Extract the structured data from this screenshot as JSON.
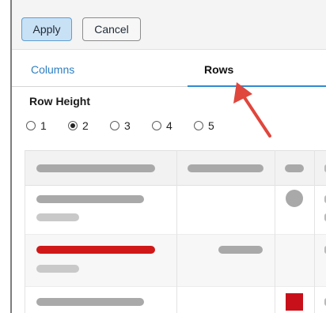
{
  "toolbar": {
    "apply_label": "Apply",
    "cancel_label": "Cancel"
  },
  "tabs": [
    {
      "label": "Columns",
      "active": false
    },
    {
      "label": "Rows",
      "active": true
    }
  ],
  "row_height": {
    "title": "Row Height",
    "options": [
      "1",
      "2",
      "3",
      "4",
      "5"
    ],
    "selected": "2"
  },
  "colors": {
    "accent": "#2e8bd0",
    "apply_bg": "#c9e1f5",
    "highlight_bar": "#d01818",
    "status_square": "#c8101a",
    "arrow": "#e0463c"
  },
  "grid_preview": {
    "header_placeholder_cells": 4,
    "rows": [
      {
        "variant": "normal",
        "status": "circle"
      },
      {
        "variant": "highlighted",
        "status": "none"
      },
      {
        "variant": "normal",
        "status": "square"
      }
    ]
  }
}
